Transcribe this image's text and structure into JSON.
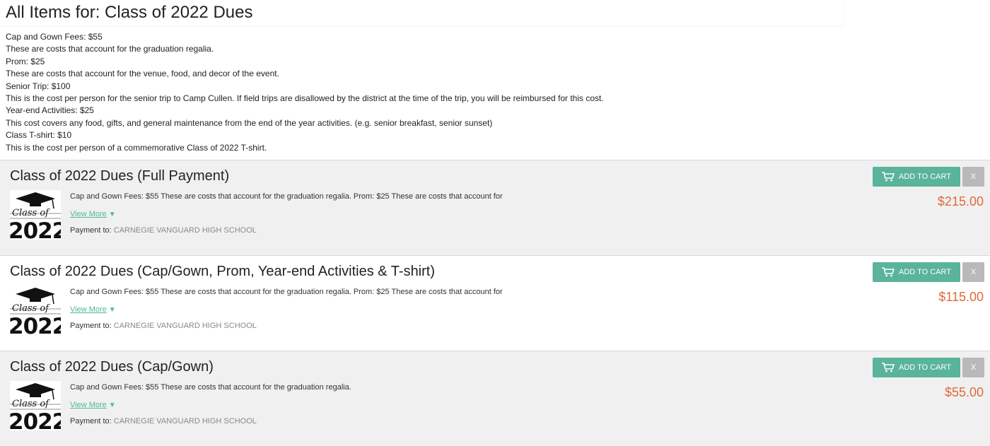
{
  "page": {
    "title": "All Items for: Class of 2022 Dues"
  },
  "description_lines": [
    "Cap and Gown Fees: $55",
    "These are costs that account for the graduation regalia.",
    "Prom: $25",
    "These are costs that account for the venue, food, and decor of the event.",
    "Senior Trip: $100",
    "This is the cost per person for the senior trip to Camp Cullen. If field trips are disallowed by the district at the time of the trip, you will be reimbursed for this cost.",
    "Year-end Activities: $25",
    "This cost covers any food, gifts, and general maintenance from the end of the year activities. (e.g. senior breakfast, senior sunset)",
    "Class T-shirt: $10",
    "This is the cost per person of a commemorative Class of 2022 T-shirt."
  ],
  "items": [
    {
      "title": "Class of 2022 Dues (Full Payment)",
      "summary": "Cap and Gown Fees: $55 These are costs that account for the graduation regalia.  Prom: $25  These are costs that account for",
      "view_more": "View More",
      "payment_label": "Payment to:",
      "payment_to": "CARNEGIE VANGUARD HIGH SCHOOL",
      "add_to_cart": "ADD TO CART",
      "remove": "X",
      "price": "$215.00"
    },
    {
      "title": "Class of 2022 Dues (Cap/Gown, Prom, Year-end Activities & T-shirt)",
      "summary": "Cap and Gown Fees: $55 These are costs that account for the graduation regalia.  Prom: $25 These are costs that account for",
      "view_more": "View More",
      "payment_label": "Payment to:",
      "payment_to": "CARNEGIE VANGUARD HIGH SCHOOL",
      "add_to_cart": "ADD TO CART",
      "remove": "X",
      "price": "$115.00"
    },
    {
      "title": "Class of 2022 Dues (Cap/Gown)",
      "summary": "Cap and Gown Fees: $55 These are costs that account for the graduation regalia.",
      "view_more": "View More",
      "payment_label": "Payment to:",
      "payment_to": "CARNEGIE VANGUARD HIGH SCHOOL",
      "add_to_cart": "ADD TO CART",
      "remove": "X",
      "price": "$55.00"
    }
  ],
  "thumbnail": {
    "script_text": "Class of",
    "year_text": "2022",
    "icon": "graduation-cap-icon"
  },
  "colors": {
    "accent": "#5ab39b",
    "price": "#e06b37",
    "link": "#4db89a",
    "remove_button": "#b9b9b9"
  }
}
